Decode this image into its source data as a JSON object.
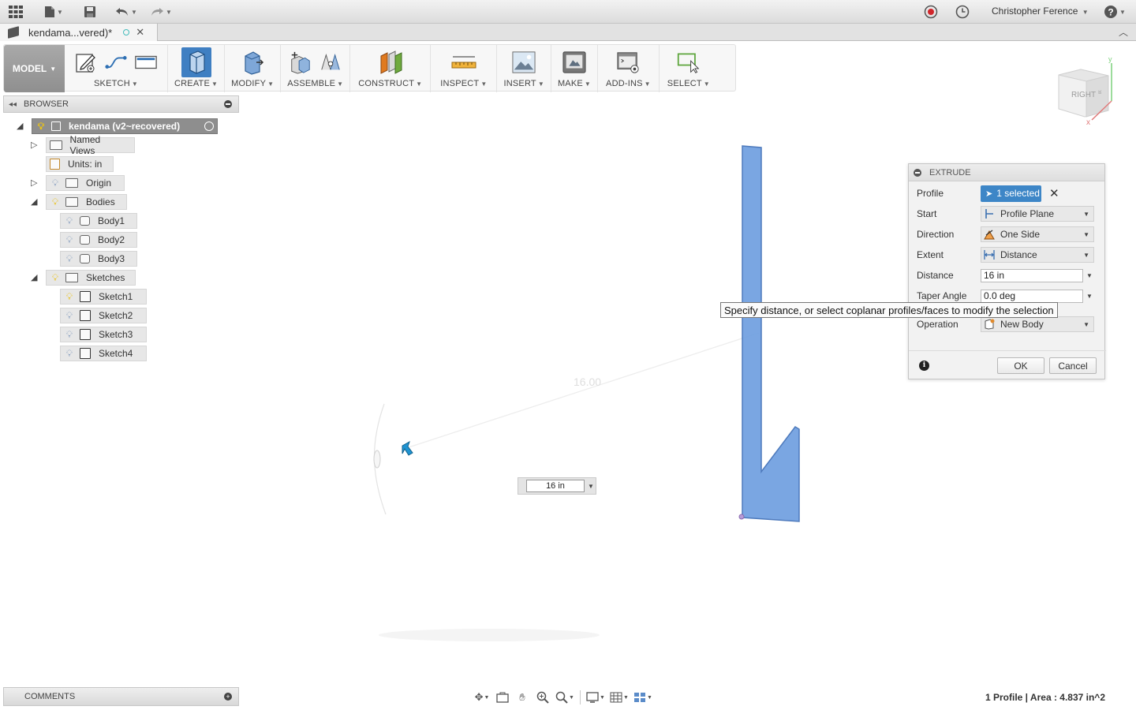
{
  "app": {
    "user_name": "Christopher Ference",
    "icons": [
      "grid-apps-icon",
      "file-icon",
      "save-icon",
      "undo-icon",
      "redo-icon",
      "record-icon",
      "clock-icon",
      "help-icon"
    ]
  },
  "document_tab": {
    "title": "kendama...vered)*"
  },
  "toolbar": {
    "workspace": "MODEL",
    "groups": [
      {
        "label": "SKETCH"
      },
      {
        "label": "CREATE"
      },
      {
        "label": "MODIFY"
      },
      {
        "label": "ASSEMBLE"
      },
      {
        "label": "CONSTRUCT"
      },
      {
        "label": "INSPECT"
      },
      {
        "label": "INSERT"
      },
      {
        "label": "MAKE"
      },
      {
        "label": "ADD-INS"
      },
      {
        "label": "SELECT"
      }
    ]
  },
  "browser": {
    "title": "BROWSER",
    "root": "kendama (v2~recovered)",
    "items": [
      {
        "label": "Named Views"
      },
      {
        "label": "Units: in"
      },
      {
        "label": "Origin"
      },
      {
        "label": "Bodies"
      },
      {
        "label": "Body1"
      },
      {
        "label": "Body2"
      },
      {
        "label": "Body3"
      },
      {
        "label": "Sketches"
      },
      {
        "label": "Sketch1"
      },
      {
        "label": "Sketch2"
      },
      {
        "label": "Sketch3"
      },
      {
        "label": "Sketch4"
      }
    ]
  },
  "comments": {
    "title": "COMMENTS"
  },
  "canvas": {
    "dimension_label": "16.00",
    "value_input": "16 in",
    "viewcube_face": "RIGHT",
    "profile_color": "#6f9fe0"
  },
  "extrude": {
    "title": "EXTRUDE",
    "rows": {
      "profile": {
        "label": "Profile",
        "value": "1 selected"
      },
      "start": {
        "label": "Start",
        "value": "Profile Plane"
      },
      "direction": {
        "label": "Direction",
        "value": "One Side"
      },
      "extent": {
        "label": "Extent",
        "value": "Distance"
      },
      "distance": {
        "label": "Distance",
        "value": "16 in"
      },
      "taper": {
        "label": "Taper Angle",
        "value": "0.0 deg"
      },
      "operation": {
        "label": "Operation",
        "value": "New Body"
      }
    },
    "ok": "OK",
    "cancel": "Cancel"
  },
  "tooltip": "Specify distance, or select coplanar profiles/faces to modify the selection",
  "status": "1 Profile | Area : 4.837 in^2"
}
